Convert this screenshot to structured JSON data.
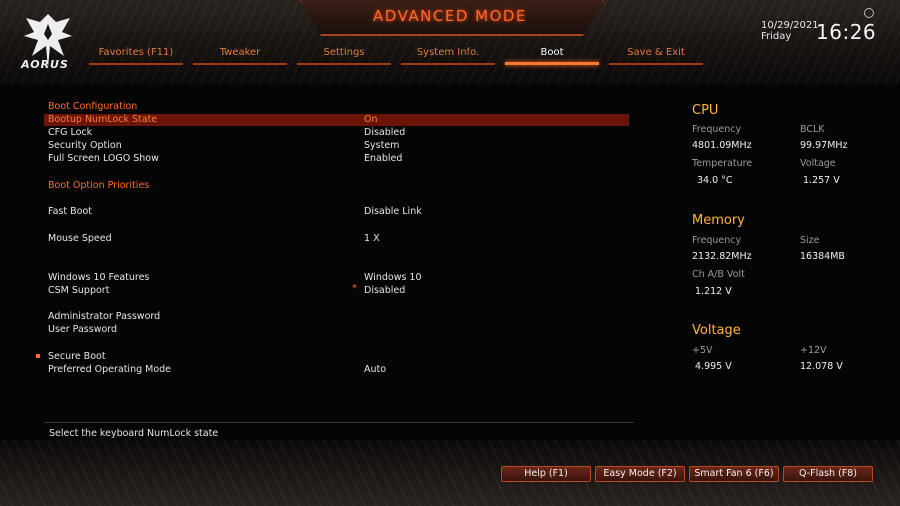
{
  "header": {
    "title": "ADVANCED MODE",
    "logo_text": "AORUS",
    "date": "10/29/2021",
    "day": "Friday",
    "time": "16:26",
    "accent_color": "#ff6a2a"
  },
  "tabs": [
    {
      "label": "Favorites (F11)"
    },
    {
      "label": "Tweaker"
    },
    {
      "label": "Settings"
    },
    {
      "label": "System Info."
    },
    {
      "label": "Boot",
      "active": true
    },
    {
      "label": "Save & Exit"
    }
  ],
  "main": {
    "sections": {
      "boot_configuration": "Boot Configuration",
      "boot_option_priorities": "Boot Option Priorities"
    },
    "rows": [
      {
        "label": "Bootup NumLock State",
        "value": "On",
        "selected": true
      },
      {
        "label": "CFG Lock",
        "value": "Disabled"
      },
      {
        "label": "Security Option",
        "value": "System"
      },
      {
        "label": "Full Screen LOGO Show",
        "value": "Enabled"
      },
      {
        "label": "Fast Boot",
        "value": "Disable Link"
      },
      {
        "label": "Mouse Speed",
        "value": "1 X"
      },
      {
        "label": "Windows 10 Features",
        "value": "Windows 10"
      },
      {
        "label": "CSM Support",
        "value": "Disabled",
        "star": "*"
      },
      {
        "label": "Administrator Password",
        "value": ""
      },
      {
        "label": "User Password",
        "value": ""
      },
      {
        "label": "Secure Boot",
        "value": ""
      },
      {
        "label": "Preferred Operating Mode",
        "value": "Auto"
      }
    ],
    "help_text": "Select the keyboard NumLock state"
  },
  "panel": {
    "cpu": {
      "title": "CPU",
      "frequency_label": "Frequency",
      "frequency": "4801.09MHz",
      "bclk_label": "BCLK",
      "bclk": "99.97MHz",
      "temperature_label": "Temperature",
      "temperature": "34.0 °C",
      "voltage_label": "Voltage",
      "voltage": "1.257 V"
    },
    "memory": {
      "title": "Memory",
      "frequency_label": "Frequency",
      "frequency": "2132.82MHz",
      "size_label": "Size",
      "size": "16384MB",
      "chab_volt_label": "Ch A/B Volt",
      "chab_volt": "1.212 V"
    },
    "voltage": {
      "title": "Voltage",
      "v5_label": "+5V",
      "v5": "4.995 V",
      "v12_label": "+12V",
      "v12": "12.078 V"
    }
  },
  "footer": {
    "help": "Help (F1)",
    "easy_mode": "Easy Mode (F2)",
    "smart_fan": "Smart Fan 6 (F6)",
    "qflash": "Q-Flash (F8)"
  }
}
